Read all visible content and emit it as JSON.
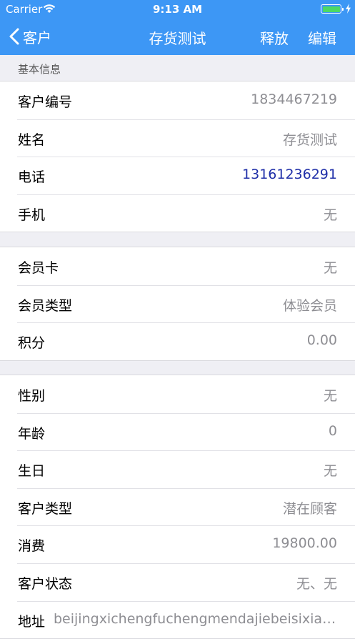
{
  "status_bar": {
    "carrier": "Carrier",
    "time": "9:13 AM",
    "battery_color": "#4cd964"
  },
  "nav": {
    "back_label": "客户",
    "title": "存货测试",
    "release_label": "释放",
    "edit_label": "编辑",
    "bar_color": "#3d97f5"
  },
  "section_basic": {
    "header": "基本信息",
    "rows": [
      {
        "label": "客户编号",
        "value": "1834467219"
      },
      {
        "label": "姓名",
        "value": "存货测试"
      },
      {
        "label": "电话",
        "value": "13161236291"
      },
      {
        "label": "手机",
        "value": "无"
      }
    ]
  },
  "section_member": {
    "rows": [
      {
        "label": "会员卡",
        "value": "无"
      },
      {
        "label": "会员类型",
        "value": "体验会员"
      },
      {
        "label": "积分",
        "value": "0.00"
      }
    ]
  },
  "section_profile": {
    "rows": [
      {
        "label": "性别",
        "value": "无"
      },
      {
        "label": "年龄",
        "value": "0"
      },
      {
        "label": "生日",
        "value": "无"
      },
      {
        "label": "客户类型",
        "value": "潜在顾客"
      },
      {
        "label": "消费",
        "value": "19800.00"
      },
      {
        "label": "客户状态",
        "value": "无、无"
      },
      {
        "label": "地址",
        "value": "beijingxichengfuchengmendajiebeisixiang..."
      }
    ]
  },
  "icons": {
    "wifi": "wifi-icon",
    "battery": "battery-icon",
    "charging": "charging-bolt-icon",
    "back": "chevron-left-icon"
  }
}
